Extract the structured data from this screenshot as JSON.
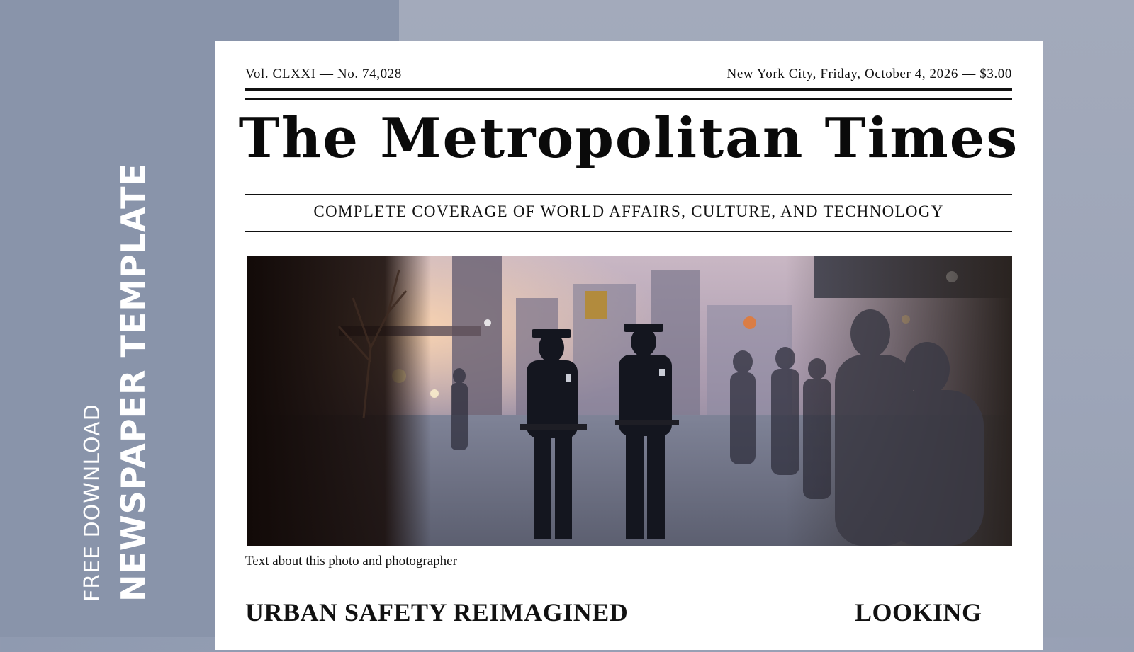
{
  "side": {
    "free_download": "FREE DOWNLOAD",
    "template_title": "NEWSPAPER TEMPLATE"
  },
  "paper": {
    "volume": "Vol. CLXXI — No. 74,028",
    "dateline": "New York City, Friday, October 4, 2026 — $3.00",
    "nameplate": "The Metropolitan Times",
    "tagline": "COMPLETE COVERAGE OF WORLD AFFAIRS, CULTURE, AND TECHNOLOGY",
    "photo_caption": "Text about this photo and photographer",
    "main_headline": "URBAN SAFETY REIMAGINED",
    "side_headline": "LOOKING"
  },
  "colors": {
    "background": "#9aa2b6",
    "paper": "#ffffff",
    "ink": "#111111"
  }
}
